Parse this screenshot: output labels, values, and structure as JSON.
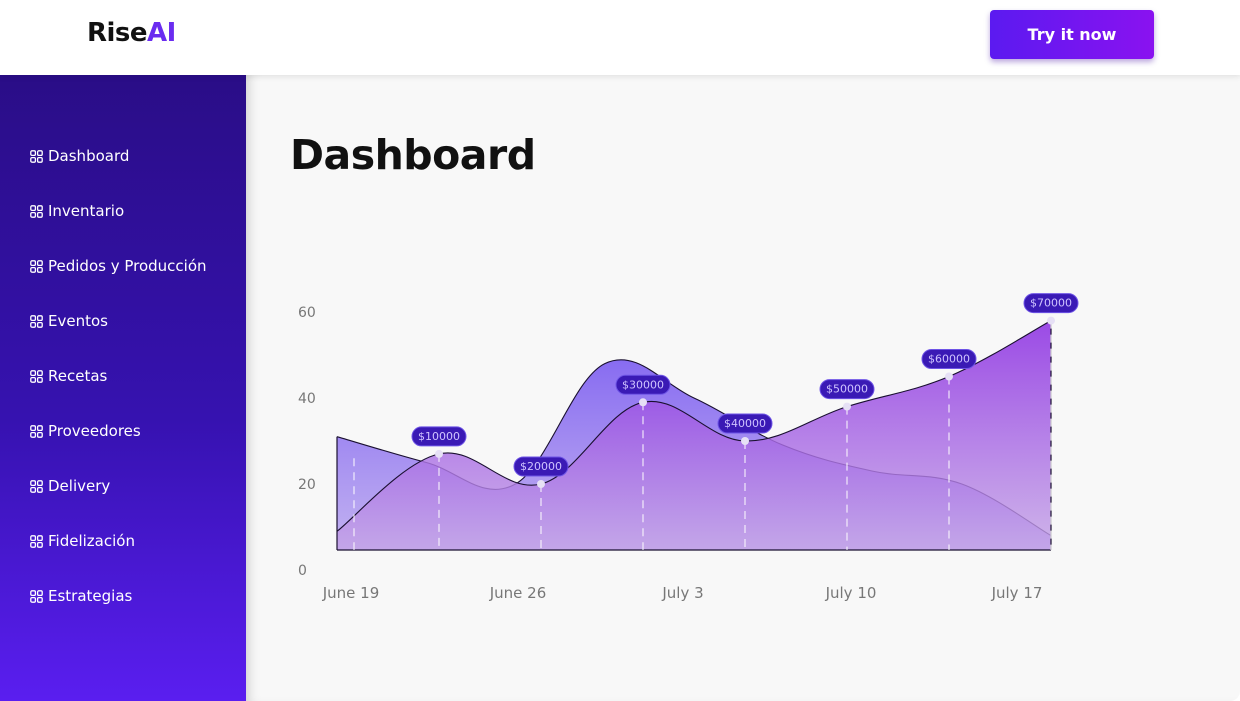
{
  "header": {
    "logo_text": "Rise",
    "logo_accent": "AI",
    "cta_label": "Try it now"
  },
  "sidebar": {
    "items": [
      {
        "label": "Dashboard",
        "icon": "grid-icon"
      },
      {
        "label": "Inventario",
        "icon": "grid-icon"
      },
      {
        "label": "Pedidos y Producción",
        "icon": "grid-icon"
      },
      {
        "label": "Eventos",
        "icon": "grid-icon"
      },
      {
        "label": "Recetas",
        "icon": "grid-icon"
      },
      {
        "label": "Proveedores",
        "icon": "grid-icon"
      },
      {
        "label": "Delivery",
        "icon": "grid-icon"
      },
      {
        "label": "Fidelización",
        "icon": "grid-icon"
      },
      {
        "label": "Estrategias",
        "icon": "grid-icon"
      }
    ]
  },
  "main": {
    "title": "Dashboard"
  },
  "colors": {
    "brand": "#6a2cf0",
    "sidebar_top": "#2a0d87",
    "sidebar_bottom": "#5a1ef0",
    "pill": "#3a1ab5"
  },
  "chart_data": {
    "type": "area",
    "title": "",
    "xlabel": "",
    "ylabel": "",
    "ylim": [
      0,
      60
    ],
    "yticks": [
      0,
      20,
      40,
      60
    ],
    "xtick_labels": [
      "June 19",
      "June 26",
      "July 3",
      "July 10",
      "July 17"
    ],
    "grid": false,
    "series": [
      {
        "values": [
          31,
          25,
          20,
          48,
          40,
          29,
          23,
          20,
          8
        ],
        "color_top": "#7b5cf0",
        "color_bottom": "#b9a6f0"
      },
      {
        "values": [
          9,
          27,
          20,
          39,
          30,
          38,
          45,
          58
        ],
        "color_top": "#8a2be2",
        "color_bottom": "#c4a3e6"
      }
    ],
    "markers": [
      {
        "label": "$10000",
        "value": 27
      },
      {
        "label": "$20000",
        "value": 20
      },
      {
        "label": "$30000",
        "value": 39
      },
      {
        "label": "$40000",
        "value": 30
      },
      {
        "label": "$50000",
        "value": 38
      },
      {
        "label": "$60000",
        "value": 45
      },
      {
        "label": "$70000",
        "value": 58
      }
    ]
  }
}
